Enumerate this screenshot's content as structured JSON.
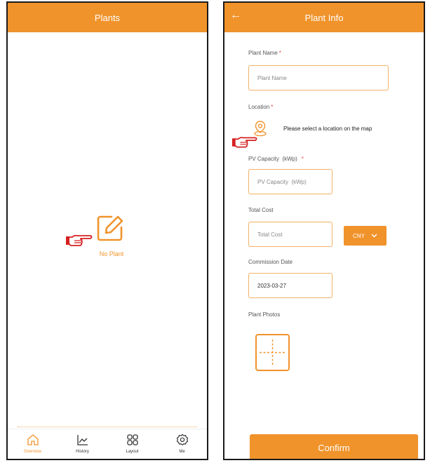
{
  "left_screen": {
    "title": "Plants",
    "empty_state": {
      "label": "No Plant",
      "icon": "edit-icon"
    },
    "nav": [
      {
        "label": "Overview",
        "icon": "home-icon",
        "active": true
      },
      {
        "label": "History",
        "icon": "chart-line-icon",
        "active": false
      },
      {
        "label": "Layout",
        "icon": "grid-icon",
        "active": false
      },
      {
        "label": "Me",
        "icon": "gear-icon",
        "active": false
      }
    ]
  },
  "right_screen": {
    "title": "Plant Info",
    "back_icon": "←",
    "required_mark": "*",
    "plant_name": {
      "label": "Plant Name",
      "placeholder": "Plant Name"
    },
    "location": {
      "label": "Location",
      "hint": "Please select a location on the map",
      "icon": "location-pin-icon"
    },
    "pv_capacity": {
      "label": "PV Capacity  (kWp)",
      "placeholder": "PV Capacity  (kWp)"
    },
    "total_cost": {
      "label": "Total Cost",
      "placeholder": "Total Cost"
    },
    "currency": {
      "value": "CNY",
      "icon": "chevron-down-icon"
    },
    "commission_date": {
      "label": "Commission Date",
      "value": "2023-03-27"
    },
    "plant_photos": {
      "label": "Plant Photos",
      "icon": "add-photo-icon"
    },
    "confirm_label": "Confirm"
  },
  "colors": {
    "accent": "#f0932b",
    "required": "#e4413f",
    "pointer": "#d62020"
  }
}
